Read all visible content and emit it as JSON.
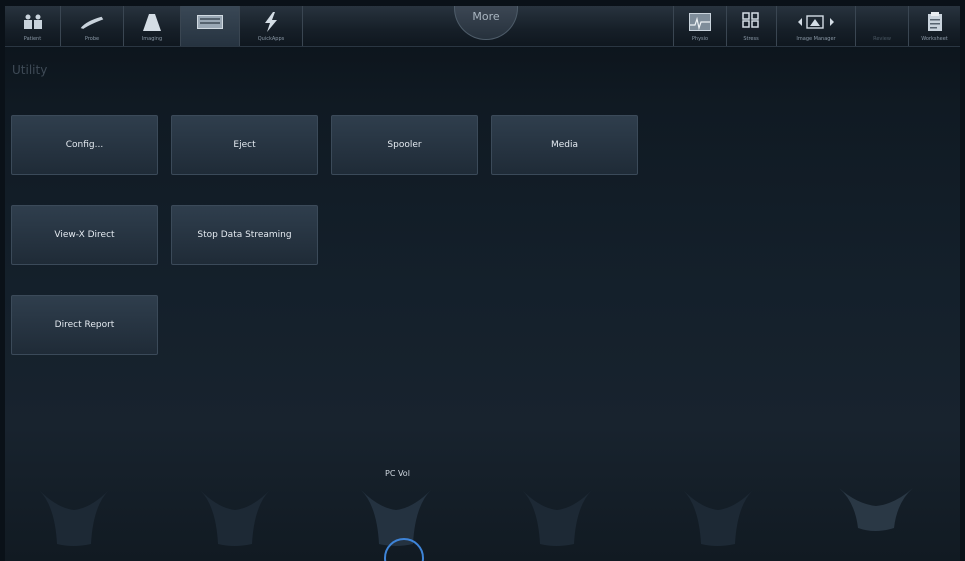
{
  "toolbar": {
    "left_items": [
      {
        "label": "Patient",
        "icon": "patient-icon"
      },
      {
        "label": "Probe",
        "icon": "probe-icon"
      },
      {
        "label": "Imaging",
        "icon": "imaging-icon"
      },
      {
        "label": "",
        "icon": "keyboard-icon"
      },
      {
        "label": "QuickApps",
        "icon": "lightning-icon"
      }
    ],
    "more_label": "More",
    "right_items": [
      {
        "label": "Physio",
        "icon": "physio-icon"
      },
      {
        "label": "Stress",
        "icon": "stress-icon"
      },
      {
        "label": "Image Manager",
        "icon": "image-manager-icon"
      },
      {
        "label": "Review",
        "icon": "review-icon"
      },
      {
        "label": "Worksheet",
        "icon": "worksheet-icon"
      }
    ]
  },
  "page": {
    "title": "Utility"
  },
  "buttons": [
    {
      "label": "Config..."
    },
    {
      "label": "Eject"
    },
    {
      "label": "Spooler"
    },
    {
      "label": "Media"
    },
    {
      "label": "View-X Direct"
    },
    {
      "label": "Stop Data Streaming"
    },
    {
      "label": "Direct Report"
    }
  ],
  "knobs": {
    "label": "PC Vol"
  },
  "colors": {
    "accent_ring": "#3e84d8",
    "button_bg": "#2a3846",
    "background": "#14202b"
  }
}
